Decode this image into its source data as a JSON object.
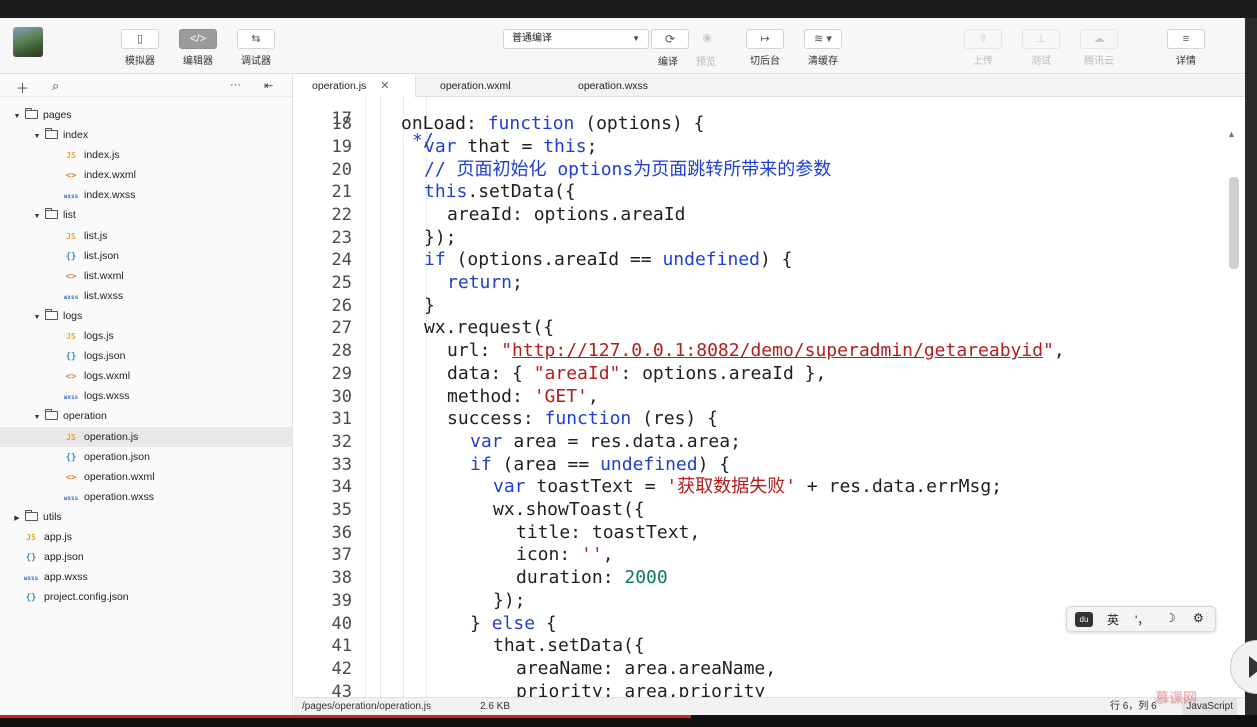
{
  "toolbar": {
    "left_buttons": [
      {
        "icon": "simulator-icon",
        "glyph": "▯",
        "label": "模拟器"
      },
      {
        "icon": "editor-icon",
        "glyph": "</>",
        "label": "编辑器"
      },
      {
        "icon": "debugger-icon",
        "glyph": "⇆",
        "label": "调试器"
      }
    ],
    "compile_mode": "普通编译",
    "compile_label": "编译",
    "preview_label": "预览",
    "backend_label": "切后台",
    "cache_label": "清缓存",
    "upload_label": "上传",
    "test_label": "测试",
    "cloud_label": "腾讯云",
    "details_label": "详情"
  },
  "sidebar": {
    "tree": [
      {
        "kind": "folder",
        "label": "pages",
        "depth": 0,
        "open": true
      },
      {
        "kind": "folder",
        "label": "index",
        "depth": 1,
        "open": true
      },
      {
        "kind": "file",
        "type": "js",
        "badge": "JS",
        "label": "index.js",
        "depth": 2
      },
      {
        "kind": "file",
        "type": "wxml",
        "badge": "<>",
        "label": "index.wxml",
        "depth": 2
      },
      {
        "kind": "file",
        "type": "wxss",
        "badge": "wxss",
        "label": "index.wxss",
        "depth": 2
      },
      {
        "kind": "folder",
        "label": "list",
        "depth": 1,
        "open": true
      },
      {
        "kind": "file",
        "type": "js",
        "badge": "JS",
        "label": "list.js",
        "depth": 2
      },
      {
        "kind": "file",
        "type": "json",
        "badge": "{}",
        "label": "list.json",
        "depth": 2
      },
      {
        "kind": "file",
        "type": "wxml",
        "badge": "<>",
        "label": "list.wxml",
        "depth": 2
      },
      {
        "kind": "file",
        "type": "wxss",
        "badge": "wxss",
        "label": "list.wxss",
        "depth": 2
      },
      {
        "kind": "folder",
        "label": "logs",
        "depth": 1,
        "open": true
      },
      {
        "kind": "file",
        "type": "js",
        "badge": "JS",
        "label": "logs.js",
        "depth": 2
      },
      {
        "kind": "file",
        "type": "json",
        "badge": "{}",
        "label": "logs.json",
        "depth": 2
      },
      {
        "kind": "file",
        "type": "wxml",
        "badge": "<>",
        "label": "logs.wxml",
        "depth": 2
      },
      {
        "kind": "file",
        "type": "wxss",
        "badge": "wxss",
        "label": "logs.wxss",
        "depth": 2
      },
      {
        "kind": "folder",
        "label": "operation",
        "depth": 1,
        "open": true
      },
      {
        "kind": "file",
        "type": "js",
        "badge": "JS",
        "label": "operation.js",
        "depth": 2,
        "selected": true
      },
      {
        "kind": "file",
        "type": "json",
        "badge": "{}",
        "label": "operation.json",
        "depth": 2
      },
      {
        "kind": "file",
        "type": "wxml",
        "badge": "<>",
        "label": "operation.wxml",
        "depth": 2
      },
      {
        "kind": "file",
        "type": "wxss",
        "badge": "wxss",
        "label": "operation.wxss",
        "depth": 2
      },
      {
        "kind": "folder",
        "label": "utils",
        "depth": 0,
        "open": false
      },
      {
        "kind": "file",
        "type": "js",
        "badge": "JS",
        "label": "app.js",
        "depth": 0
      },
      {
        "kind": "file",
        "type": "json",
        "badge": "{}",
        "label": "app.json",
        "depth": 0
      },
      {
        "kind": "file",
        "type": "wxss",
        "badge": "wxss",
        "label": "app.wxss",
        "depth": 0
      },
      {
        "kind": "file",
        "type": "json",
        "badge": "{}",
        "label": "project.config.json",
        "depth": 0
      }
    ]
  },
  "tabs": [
    {
      "label": "operation.js",
      "active": true
    },
    {
      "label": "operation.wxml",
      "active": false
    },
    {
      "label": "operation.wxss",
      "active": false
    }
  ],
  "editor": {
    "partial_line_number": "17",
    "partial_line_text": "*/",
    "lines": [
      {
        "n": "18",
        "indent": 0,
        "tokens": [
          [
            "",
            "onLoad: "
          ],
          [
            "kw",
            "function"
          ],
          [
            "",
            " (options) {"
          ]
        ]
      },
      {
        "n": "19",
        "indent": 1,
        "tokens": [
          [
            "kw",
            "var"
          ],
          [
            "",
            " that = "
          ],
          [
            "kw",
            "this"
          ],
          [
            "",
            ";"
          ]
        ]
      },
      {
        "n": "20",
        "indent": 1,
        "tokens": [
          [
            "cm",
            "// 页面初始化 options为页面跳转所带来的参数"
          ]
        ]
      },
      {
        "n": "21",
        "indent": 1,
        "tokens": [
          [
            "kw",
            "this"
          ],
          [
            "",
            ".setData({"
          ]
        ]
      },
      {
        "n": "22",
        "indent": 2,
        "tokens": [
          [
            "",
            "areaId: options.areaId"
          ]
        ]
      },
      {
        "n": "23",
        "indent": 1,
        "tokens": [
          [
            "",
            "});"
          ]
        ]
      },
      {
        "n": "24",
        "indent": 1,
        "tokens": [
          [
            "kw",
            "if"
          ],
          [
            "",
            " (options.areaId == "
          ],
          [
            "kw",
            "undefined"
          ],
          [
            "",
            ") {"
          ]
        ]
      },
      {
        "n": "25",
        "indent": 2,
        "tokens": [
          [
            "kw",
            "return"
          ],
          [
            "",
            ";"
          ]
        ]
      },
      {
        "n": "26",
        "indent": 1,
        "tokens": [
          [
            "",
            "}"
          ]
        ]
      },
      {
        "n": "27",
        "indent": 1,
        "tokens": [
          [
            "",
            "wx.request({"
          ]
        ]
      },
      {
        "n": "28",
        "indent": 2,
        "tokens": [
          [
            "",
            "url: "
          ],
          [
            "str",
            "\""
          ],
          [
            "str url",
            "http://127.0.0.1:8082/demo/superadmin/getareabyid"
          ],
          [
            "str",
            "\""
          ],
          [
            "",
            ","
          ]
        ]
      },
      {
        "n": "29",
        "indent": 2,
        "tokens": [
          [
            "",
            "data: { "
          ],
          [
            "str",
            "\"areaId\""
          ],
          [
            "",
            ": options.areaId },"
          ]
        ]
      },
      {
        "n": "30",
        "indent": 2,
        "tokens": [
          [
            "",
            "method: "
          ],
          [
            "str",
            "'GET'"
          ],
          [
            "",
            ","
          ]
        ]
      },
      {
        "n": "31",
        "indent": 2,
        "tokens": [
          [
            "",
            "success: "
          ],
          [
            "kw",
            "function"
          ],
          [
            "",
            " (res) {"
          ]
        ]
      },
      {
        "n": "32",
        "indent": 3,
        "tokens": [
          [
            "kw",
            "var"
          ],
          [
            "",
            " area = res.data.area;"
          ]
        ]
      },
      {
        "n": "33",
        "indent": 3,
        "tokens": [
          [
            "kw",
            "if"
          ],
          [
            "",
            " (area == "
          ],
          [
            "kw",
            "undefined"
          ],
          [
            "",
            ") {"
          ]
        ]
      },
      {
        "n": "34",
        "indent": 4,
        "tokens": [
          [
            "kw",
            "var"
          ],
          [
            "",
            " toastText = "
          ],
          [
            "str",
            "'获取数据失败'"
          ],
          [
            "",
            " + res.data.errMsg;"
          ]
        ]
      },
      {
        "n": "35",
        "indent": 4,
        "tokens": [
          [
            "",
            "wx.showToast({"
          ]
        ]
      },
      {
        "n": "36",
        "indent": 5,
        "tokens": [
          [
            "",
            "title: toastText,"
          ]
        ]
      },
      {
        "n": "37",
        "indent": 5,
        "tokens": [
          [
            "",
            "icon: "
          ],
          [
            "str",
            "''"
          ],
          [
            "",
            ","
          ]
        ]
      },
      {
        "n": "38",
        "indent": 5,
        "tokens": [
          [
            "",
            "duration: "
          ],
          [
            "num",
            "2000"
          ]
        ]
      },
      {
        "n": "39",
        "indent": 4,
        "tokens": [
          [
            "",
            "});"
          ]
        ]
      },
      {
        "n": "40",
        "indent": 3,
        "tokens": [
          [
            "",
            "} "
          ],
          [
            "kw",
            "else"
          ],
          [
            "",
            " {"
          ]
        ]
      },
      {
        "n": "41",
        "indent": 4,
        "tokens": [
          [
            "",
            "that.setData({"
          ]
        ]
      },
      {
        "n": "42",
        "indent": 5,
        "tokens": [
          [
            "",
            "areaName: area.areaName,"
          ]
        ]
      },
      {
        "n": "43",
        "indent": 5,
        "tokens": [
          [
            "",
            "priority: area.priority"
          ]
        ]
      }
    ]
  },
  "ime": {
    "logo": "du",
    "lang": "英",
    "punct": "'，",
    "moon": "☽",
    "gear": "⚙"
  },
  "status": {
    "path": "/pages/operation/operation.js",
    "size": "2.6 KB",
    "position": "行 6，列 6",
    "language": "JavaScript"
  },
  "watermark": "慕课网",
  "video_progress": 0.55,
  "colors": {
    "keyword": "#1f3fd3",
    "string": "#b51c1c",
    "number": "#0b7a5a",
    "progress": "#d0211b"
  }
}
